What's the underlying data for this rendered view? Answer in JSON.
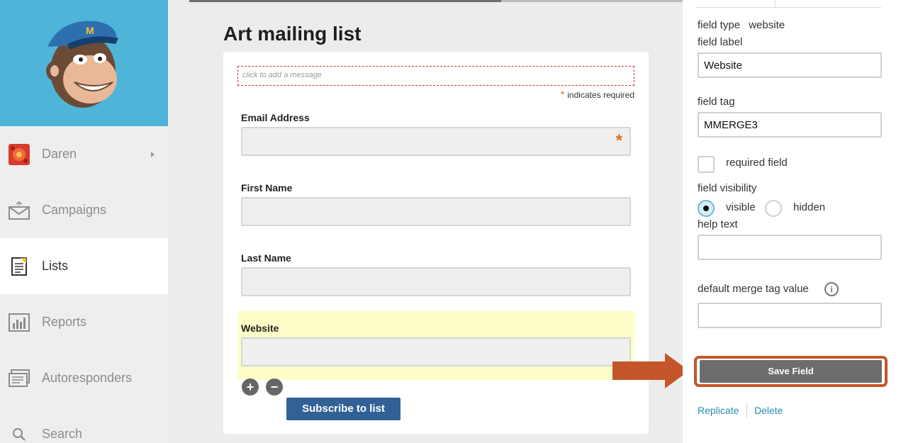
{
  "sidebar": {
    "user_name": "Daren",
    "items": [
      {
        "label": "Campaigns",
        "icon": "envelope-icon"
      },
      {
        "label": "Lists",
        "icon": "list-document-icon"
      },
      {
        "label": "Reports",
        "icon": "bar-chart-icon"
      },
      {
        "label": "Autoresponders",
        "icon": "autoresponder-icon"
      },
      {
        "label": "Search",
        "icon": "search-icon"
      }
    ],
    "active_item": "Lists",
    "logo_color": "#4eb5d9"
  },
  "main": {
    "title": "Art mailing list",
    "message_placeholder": "click to add a message",
    "required_star": "*",
    "required_note": "indicates required",
    "fields": [
      {
        "label": "Email Address",
        "required": true
      },
      {
        "label": "First Name",
        "required": false
      },
      {
        "label": "Last Name",
        "required": false
      },
      {
        "label": "Website",
        "required": false,
        "selected": true
      }
    ],
    "add_symbol": "+",
    "remove_symbol": "−",
    "subscribe_label": "Subscribe to list"
  },
  "panel": {
    "field_type_label": "field type",
    "field_type_value": "website",
    "field_label_label": "field label",
    "field_label_value": "Website",
    "field_tag_label": "field tag",
    "field_tag_value": "MMERGE3",
    "required_label": "required field",
    "required_checked": false,
    "visibility_label": "field visibility",
    "visible_label": "visible",
    "hidden_label": "hidden",
    "visibility_selected": "visible",
    "help_text_label": "help text",
    "help_text_value": "",
    "default_merge_label": "default merge tag value",
    "default_merge_value": "",
    "info_symbol": "i",
    "save_label": "Save Field",
    "replicate_label": "Replicate",
    "delete_label": "Delete"
  },
  "colors": {
    "accent_annotation": "#c4562a",
    "subscribe_button": "#326295",
    "link": "#2b8bb0",
    "highlight": "#fdfdc9"
  }
}
